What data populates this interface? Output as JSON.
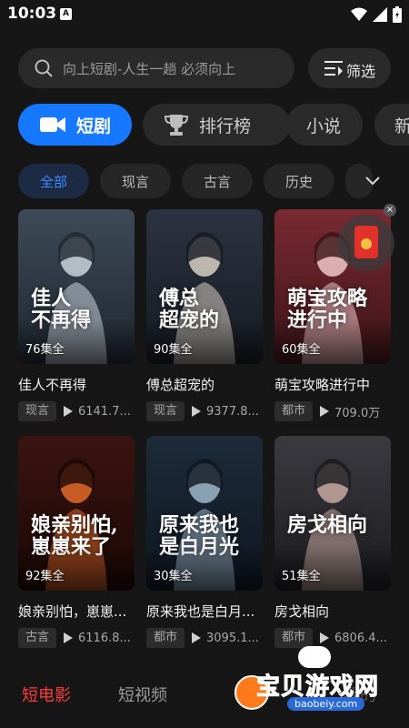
{
  "status_bar": {
    "time": "10:03",
    "badge": "A"
  },
  "search": {
    "placeholder": "向上短剧-人生一趟 必须向上"
  },
  "filter": {
    "label": "筛选"
  },
  "tabs": [
    {
      "label": "短剧",
      "icon": "video-camera-icon",
      "active": true
    },
    {
      "label": "排行榜",
      "icon": "trophy-icon",
      "active": false
    },
    {
      "label": "小说",
      "active": false
    },
    {
      "label": "新",
      "active": false
    }
  ],
  "categories": [
    {
      "label": "全部",
      "active": true
    },
    {
      "label": "现言"
    },
    {
      "label": "古言"
    },
    {
      "label": "历史"
    }
  ],
  "dramas": [
    {
      "title": "佳人不再得",
      "episodes": "76集全",
      "genre": "现言",
      "views": "6141.7...",
      "cover_text": "佳人\n不再得",
      "palette": [
        "#3d4a57",
        "#c9d3dc",
        "#1f2730"
      ]
    },
    {
      "title": "傅总超宠的",
      "episodes": "90集全",
      "genre": "现言",
      "views": "9377.8...",
      "cover_text": "傅总\n超宠的",
      "palette": [
        "#2c3340",
        "#d8cfc4",
        "#151a22"
      ]
    },
    {
      "title": "萌宝攻略进行中",
      "episodes": "60集全",
      "genre": "都市",
      "views": "709.0万",
      "cover_text": "萌宝攻略\n进行中",
      "palette": [
        "#7a2a32",
        "#f0c7c9",
        "#3a1418"
      ]
    },
    {
      "title": "娘亲别怕，崽崽...",
      "episodes": "92集全",
      "genre": "古言",
      "views": "6116.8...",
      "cover_text": "娘亲别怕,\n崽崽来了",
      "palette": [
        "#3a1410",
        "#e06a2a",
        "#1a0806"
      ]
    },
    {
      "title": "原来我也是白月...",
      "episodes": "30集全",
      "genre": "都市",
      "views": "3095.1...",
      "cover_text": "原来我也\n是白月光",
      "palette": [
        "#1d2b3a",
        "#9fb7c8",
        "#0e1620"
      ]
    },
    {
      "title": "房戈相向",
      "episodes": "51集全",
      "genre": "都市",
      "views": "6806.4...",
      "cover_text": "房戈相向",
      "palette": [
        "#3a3a40",
        "#c8a9a0",
        "#1a1a1e"
      ]
    }
  ],
  "bottom_nav": [
    {
      "label": "短电影",
      "active": true
    },
    {
      "label": "短视频",
      "active": false
    },
    {
      "label": "我的",
      "active": false
    }
  ],
  "watermark": {
    "text": "宝贝游戏网",
    "url": "baobeiy.com"
  },
  "colors": {
    "accent": "#1677ff",
    "active_bottom": "#ff3b3b",
    "background": "#161616"
  }
}
